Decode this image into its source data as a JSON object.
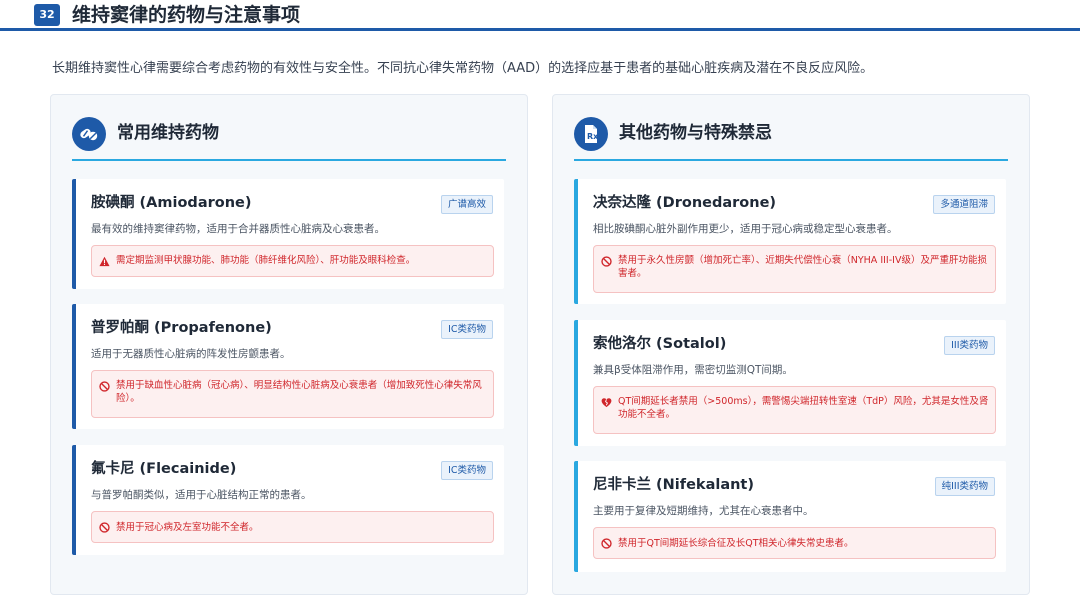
{
  "header": {
    "page_number": "32",
    "title": "维持窦律的药物与注意事项"
  },
  "intro": "长期维持窦性心律需要综合考虑药物的有效性与安全性。不同抗心律失常药物（AAD）的选择应基于患者的基础心脏疾病及潜在不良反应风险。",
  "left_panel": {
    "icon": "pills-icon",
    "title": "常用维持药物",
    "cards": [
      {
        "name": "胺碘酮 (Amiodarone)",
        "badge": "广谱高效",
        "desc": "最有效的维持窦律药物，适用于合并器质性心脏病及心衰患者。",
        "warn_icon": "warning-triangle-icon",
        "warn": "需定期监测甲状腺功能、肺功能（肺纤维化风险）、肝功能及眼科检查。"
      },
      {
        "name": "普罗帕酮 (Propafenone)",
        "badge": "IC类药物",
        "desc": "适用于无器质性心脏病的阵发性房颤患者。",
        "warn_icon": "ban-icon",
        "warn": "禁用于缺血性心脏病（冠心病）、明显结构性心脏病及心衰患者（增加致死性心律失常风险）。"
      },
      {
        "name": "氟卡尼 (Flecainide)",
        "badge": "IC类药物",
        "desc": "与普罗帕酮类似，适用于心脏结构正常的患者。",
        "warn_icon": "ban-icon",
        "warn": "禁用于冠心病及左室功能不全者。"
      }
    ]
  },
  "right_panel": {
    "icon": "prescription-file-icon",
    "title": "其他药物与特殊禁忌",
    "cards": [
      {
        "name": "决奈达隆 (Dronedarone)",
        "badge": "多通道阻滞",
        "desc": "相比胺碘酮心脏外副作用更少，适用于冠心病或稳定型心衰患者。",
        "warn_icon": "ban-icon",
        "warn": "禁用于永久性房颤（增加死亡率）、近期失代偿性心衰（NYHA III-IV级）及严重肝功能损害者。"
      },
      {
        "name": "索他洛尔 (Sotalol)",
        "badge": "III类药物",
        "desc": "兼具β受体阻滞作用，需密切监测QT间期。",
        "warn_icon": "heart-crack-icon",
        "warn": "QT间期延长者禁用（>500ms），需警惕尖端扭转性室速（TdP）风险，尤其是女性及肾功能不全者。"
      },
      {
        "name": "尼非卡兰 (Nifekalant)",
        "badge": "纯III类药物",
        "desc": "主要用于复律及短期维持，尤其在心衰患者中。",
        "warn_icon": "ban-icon",
        "warn": "禁用于QT间期延长综合征及长QT相关心律失常史患者。"
      }
    ]
  },
  "colors": {
    "primary": "#1e5aa8",
    "accent": "#2aa8e0",
    "warning_text": "#d0262b",
    "warning_bg": "#fdf0f0"
  }
}
